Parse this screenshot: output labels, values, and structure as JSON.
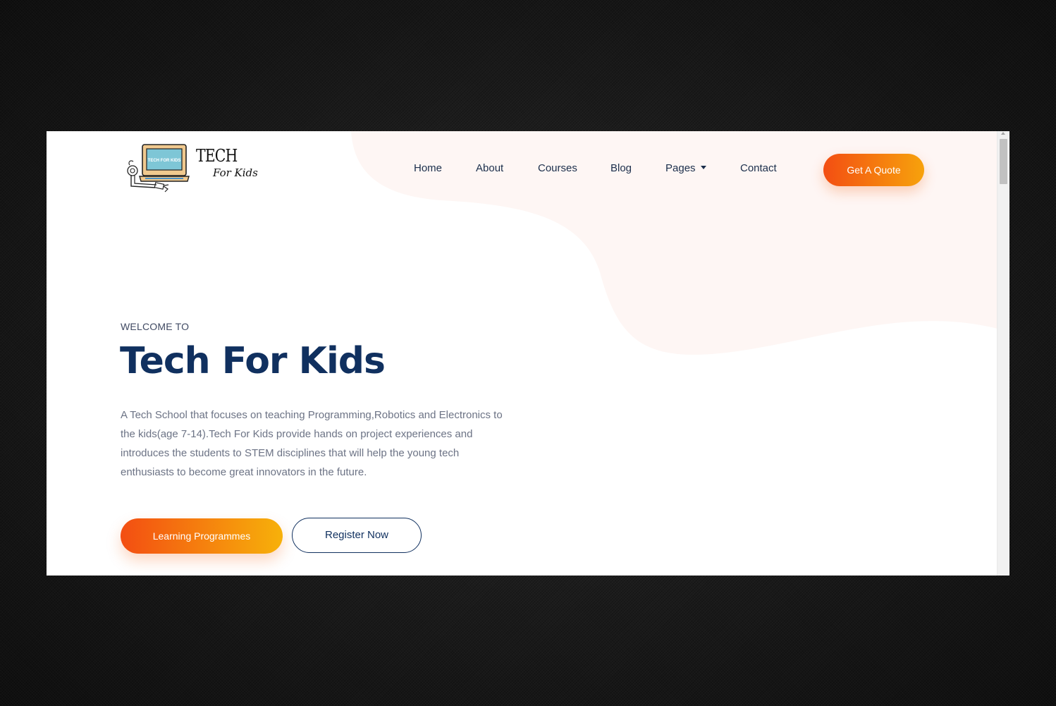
{
  "brand": {
    "logo_screen_text": "TECH FOR KIDS",
    "logo_title": "TECH",
    "logo_subtitle": "For Kids"
  },
  "nav": {
    "items": [
      {
        "label": "Home"
      },
      {
        "label": "About"
      },
      {
        "label": "Courses"
      },
      {
        "label": "Blog"
      },
      {
        "label": "Pages",
        "has_dropdown": true
      },
      {
        "label": "Contact"
      }
    ],
    "cta_label": "Get A Quote"
  },
  "hero": {
    "eyebrow": "WELCOME TO",
    "title": "Tech For Kids",
    "description": "A Tech School that focuses on teaching Programming,Robotics and Electronics to the kids(age 7-14).Tech For Kids provide hands on project experiences and introduces the students to STEM disciplines that will help the young tech enthusiasts to become great innovators in the future.",
    "primary_button": "Learning Programmes",
    "secondary_button": "Register Now"
  },
  "colors": {
    "accent_gradient_start": "#f34e12",
    "accent_gradient_end": "#f7a20c",
    "heading": "#10305f",
    "blob": "#fef6f4"
  },
  "icons": {
    "dropdown": "caret-down-icon",
    "logo": "laptop-robot-arm-logo"
  }
}
